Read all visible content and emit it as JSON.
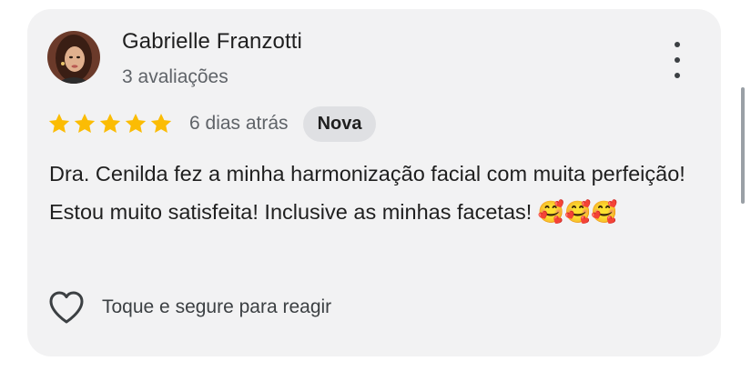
{
  "review": {
    "author_name": "Gabrielle Franzotti",
    "author_subtitle": "3 avaliações",
    "rating": 5,
    "rating_max": 5,
    "date": "6 dias atrás",
    "badge": "Nova",
    "text": "Dra. Cenilda fez a minha harmonização facial com muita perfeição! Estou muito satisfeita! Inclusive as minhas facetas! 🥰🥰🥰",
    "react_label": "Toque e segure para reagir"
  },
  "icons": {
    "avatar": "profile-photo",
    "menu": "more-vert-icon",
    "star": "star-icon",
    "react": "heart-outline-icon"
  },
  "colors": {
    "star": "#fbbc04",
    "card_background": "#f2f2f3",
    "badge_background": "#dfe0e3",
    "primary_text": "#1f1f1f",
    "secondary_text": "#5f6368"
  }
}
